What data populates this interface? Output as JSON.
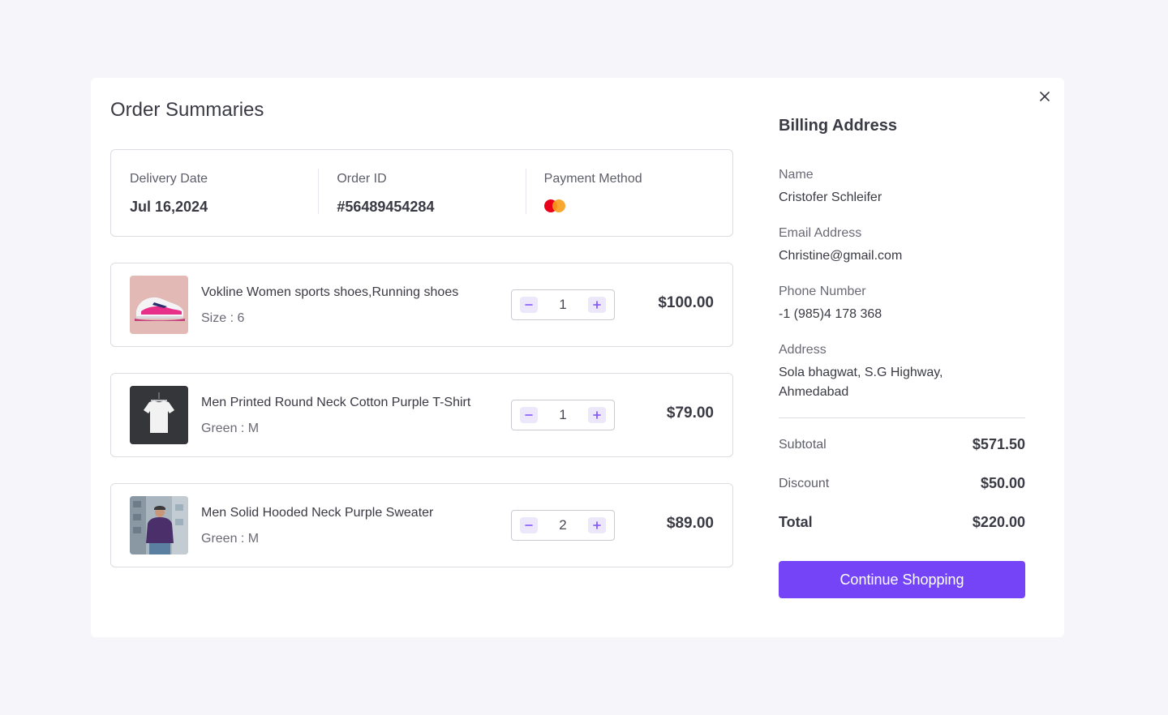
{
  "order": {
    "title": "Order Summaries",
    "info": {
      "delivery_label": "Delivery Date",
      "delivery_value": "Jul 16,2024",
      "order_id_label": "Order ID",
      "order_id_value": "#56489454284",
      "payment_label": "Payment Method",
      "payment_icon": "mastercard-icon"
    },
    "items": [
      {
        "name": "Vokline Women sports shoes,Running shoes",
        "variant": "Size : 6",
        "qty": "1",
        "price": "$100.00",
        "thumb": "sneaker-photo"
      },
      {
        "name": "Men Printed Round Neck Cotton Purple T-Shirt",
        "variant": "Green : M",
        "qty": "1",
        "price": "$79.00",
        "thumb": "tshirt-photo"
      },
      {
        "name": "Men Solid Hooded Neck Purple Sweater",
        "variant": "Green : M",
        "qty": "2",
        "price": "$89.00",
        "thumb": "hoodie-photo"
      }
    ]
  },
  "billing": {
    "title": "Billing Address",
    "name_label": "Name",
    "name_value": "Cristofer Schleifer",
    "email_label": "Email Address",
    "email_value": "Christine@gmail.com",
    "phone_label": "Phone Number",
    "phone_value": "-1 (985)4 178 368",
    "address_label": "Address",
    "address_value": "Sola bhagwat, S.G Highway, Ahmedabad"
  },
  "summary": {
    "subtotal_label": "Subtotal",
    "subtotal_value": "$571.50",
    "discount_label": "Discount",
    "discount_value": "$50.00",
    "total_label": "Total",
    "total_value": "$220.00",
    "continue_label": "Continue Shopping"
  },
  "colors": {
    "accent": "#7444f6",
    "stepper_bg": "#ede7fc",
    "mastercard_red": "#eb001b",
    "mastercard_orange": "#f79e1b"
  }
}
